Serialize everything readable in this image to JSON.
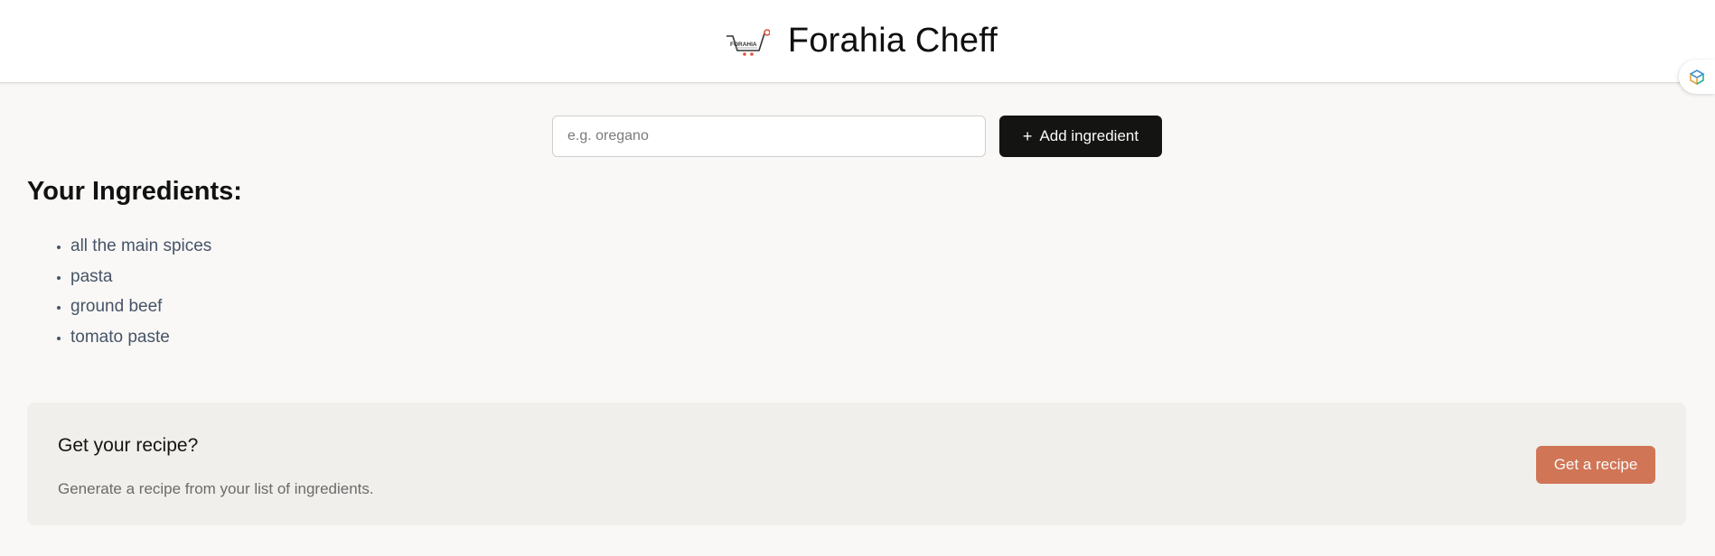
{
  "header": {
    "title": "Forahia Cheff",
    "logo": {
      "icon": "shopping-cart-logo",
      "text": "FORAHIA"
    },
    "extension_icon": "extension-cube-icon"
  },
  "form": {
    "input_placeholder": "e.g. oregano",
    "input_value": "",
    "add_button_icon": "+",
    "add_button_label": "Add ingredient"
  },
  "ingredients": {
    "heading": "Your Ingredients:",
    "items": [
      "all the main spices",
      "pasta",
      "ground beef",
      "tomato paste"
    ]
  },
  "recipe_card": {
    "title": "Get your recipe?",
    "description": "Generate a recipe from your list of ingredients.",
    "button_label": "Get a recipe"
  },
  "colors": {
    "background": "#f9f8f6",
    "header_background": "#ffffff",
    "add_button": "#141413",
    "recipe_button": "#d17557",
    "recipe_card": "#f0efeb",
    "list_text": "#475467"
  }
}
